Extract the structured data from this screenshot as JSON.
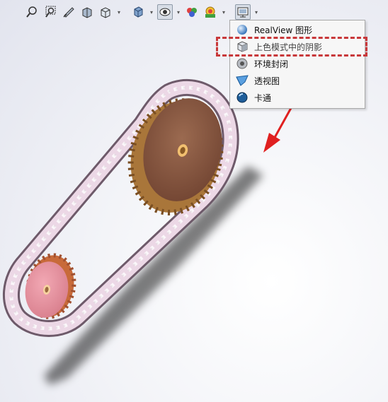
{
  "toolbar": {
    "buttons": [
      {
        "name": "zoom-to-fit-icon"
      },
      {
        "name": "zoom-to-area-icon"
      },
      {
        "name": "previous-view-icon"
      },
      {
        "name": "section-view-icon"
      },
      {
        "name": "view-orientation-icon"
      },
      {
        "name": "display-style-icon"
      },
      {
        "name": "hide-show-items-icon"
      },
      {
        "name": "edit-appearance-icon"
      },
      {
        "name": "apply-scene-icon"
      },
      {
        "name": "view-settings-icon"
      }
    ]
  },
  "menu": {
    "items": [
      {
        "label": "RealView 图形",
        "icon": "realview-sphere-icon"
      },
      {
        "label": "上色模式中的阴影",
        "icon": "shaded-cube-icon",
        "highlighted": true
      },
      {
        "label": "环境封闭",
        "icon": "ambient-occlusion-icon"
      },
      {
        "label": "透视图",
        "icon": "perspective-icon"
      },
      {
        "label": "卡通",
        "icon": "cartoon-icon"
      }
    ]
  },
  "colors": {
    "highlight": "#c8383a",
    "arrow": "#e02020",
    "large_sprocket": "#8c5a42",
    "small_sprocket": "#e8919e",
    "chain": "#e8d4e0"
  }
}
